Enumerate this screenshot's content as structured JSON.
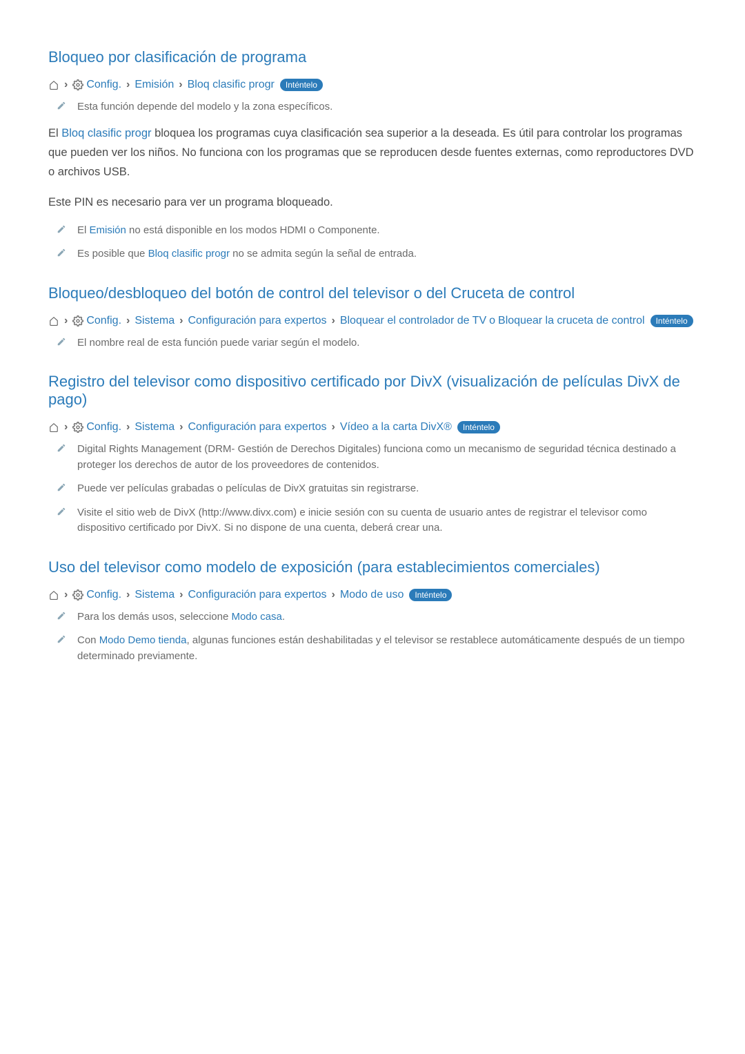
{
  "sections": {
    "s1": {
      "title": "Bloqueo por clasificación de programa",
      "breadcrumb": {
        "config": "Config.",
        "item1": "Emisión",
        "item2": "Bloq clasific progr",
        "try": "Inténtelo"
      },
      "note1": "Esta función depende del modelo y la zona específicos.",
      "body1_prefix": "El ",
      "body1_link": "Bloq clasific progr",
      "body1_suffix": " bloquea los programas cuya clasificación sea superior a la deseada. Es útil para controlar los programas que pueden ver los niños. No funciona con los programas que se reproducen desde fuentes externas, como reproductores DVD o archivos USB.",
      "body2": "Este PIN es necesario para ver un programa bloqueado.",
      "note2_prefix": "El ",
      "note2_link": "Emisión",
      "note2_suffix": " no está disponible en los modos HDMI o Componente.",
      "note3_prefix": "Es posible que ",
      "note3_link": "Bloq clasific progr",
      "note3_suffix": " no se admita según la señal de entrada."
    },
    "s2": {
      "title": "Bloqueo/desbloqueo del botón de control del televisor o del Cruceta de control",
      "breadcrumb": {
        "config": "Config.",
        "item1": "Sistema",
        "item2": "Configuración para expertos",
        "item3": "Bloquear el controlador de TV",
        "or": " o ",
        "item4": "Bloquear la cruceta de control",
        "try": "Inténtelo"
      },
      "note1": "El nombre real de esta función puede variar según el modelo."
    },
    "s3": {
      "title": "Registro del televisor como dispositivo certificado por DivX (visualización de películas DivX de pago)",
      "breadcrumb": {
        "config": "Config.",
        "item1": "Sistema",
        "item2": "Configuración para expertos",
        "item3": "Vídeo a la carta DivX®",
        "try": "Inténtelo"
      },
      "note1": "Digital Rights Management (DRM- Gestión de Derechos Digitales) funciona como un mecanismo de seguridad técnica destinado a proteger los derechos de autor de los proveedores de contenidos.",
      "note2": "Puede ver películas grabadas o películas de DivX gratuitas sin registrarse.",
      "note3": "Visite el sitio web de DivX (http://www.divx.com) e inicie sesión con su cuenta de usuario antes de registrar el televisor como dispositivo certificado por DivX. Si no dispone de una cuenta, deberá crear una."
    },
    "s4": {
      "title": "Uso del televisor como modelo de exposición (para establecimientos comerciales)",
      "breadcrumb": {
        "config": "Config.",
        "item1": "Sistema",
        "item2": "Configuración para expertos",
        "item3": "Modo de uso",
        "try": "Inténtelo"
      },
      "note1_prefix": "Para los demás usos, seleccione ",
      "note1_link": "Modo casa",
      "note1_suffix": ".",
      "note2_prefix": "Con ",
      "note2_link": "Modo Demo tienda",
      "note2_suffix": ", algunas funciones están deshabilitadas y el televisor se restablece automáticamente después de un tiempo determinado previamente."
    }
  }
}
